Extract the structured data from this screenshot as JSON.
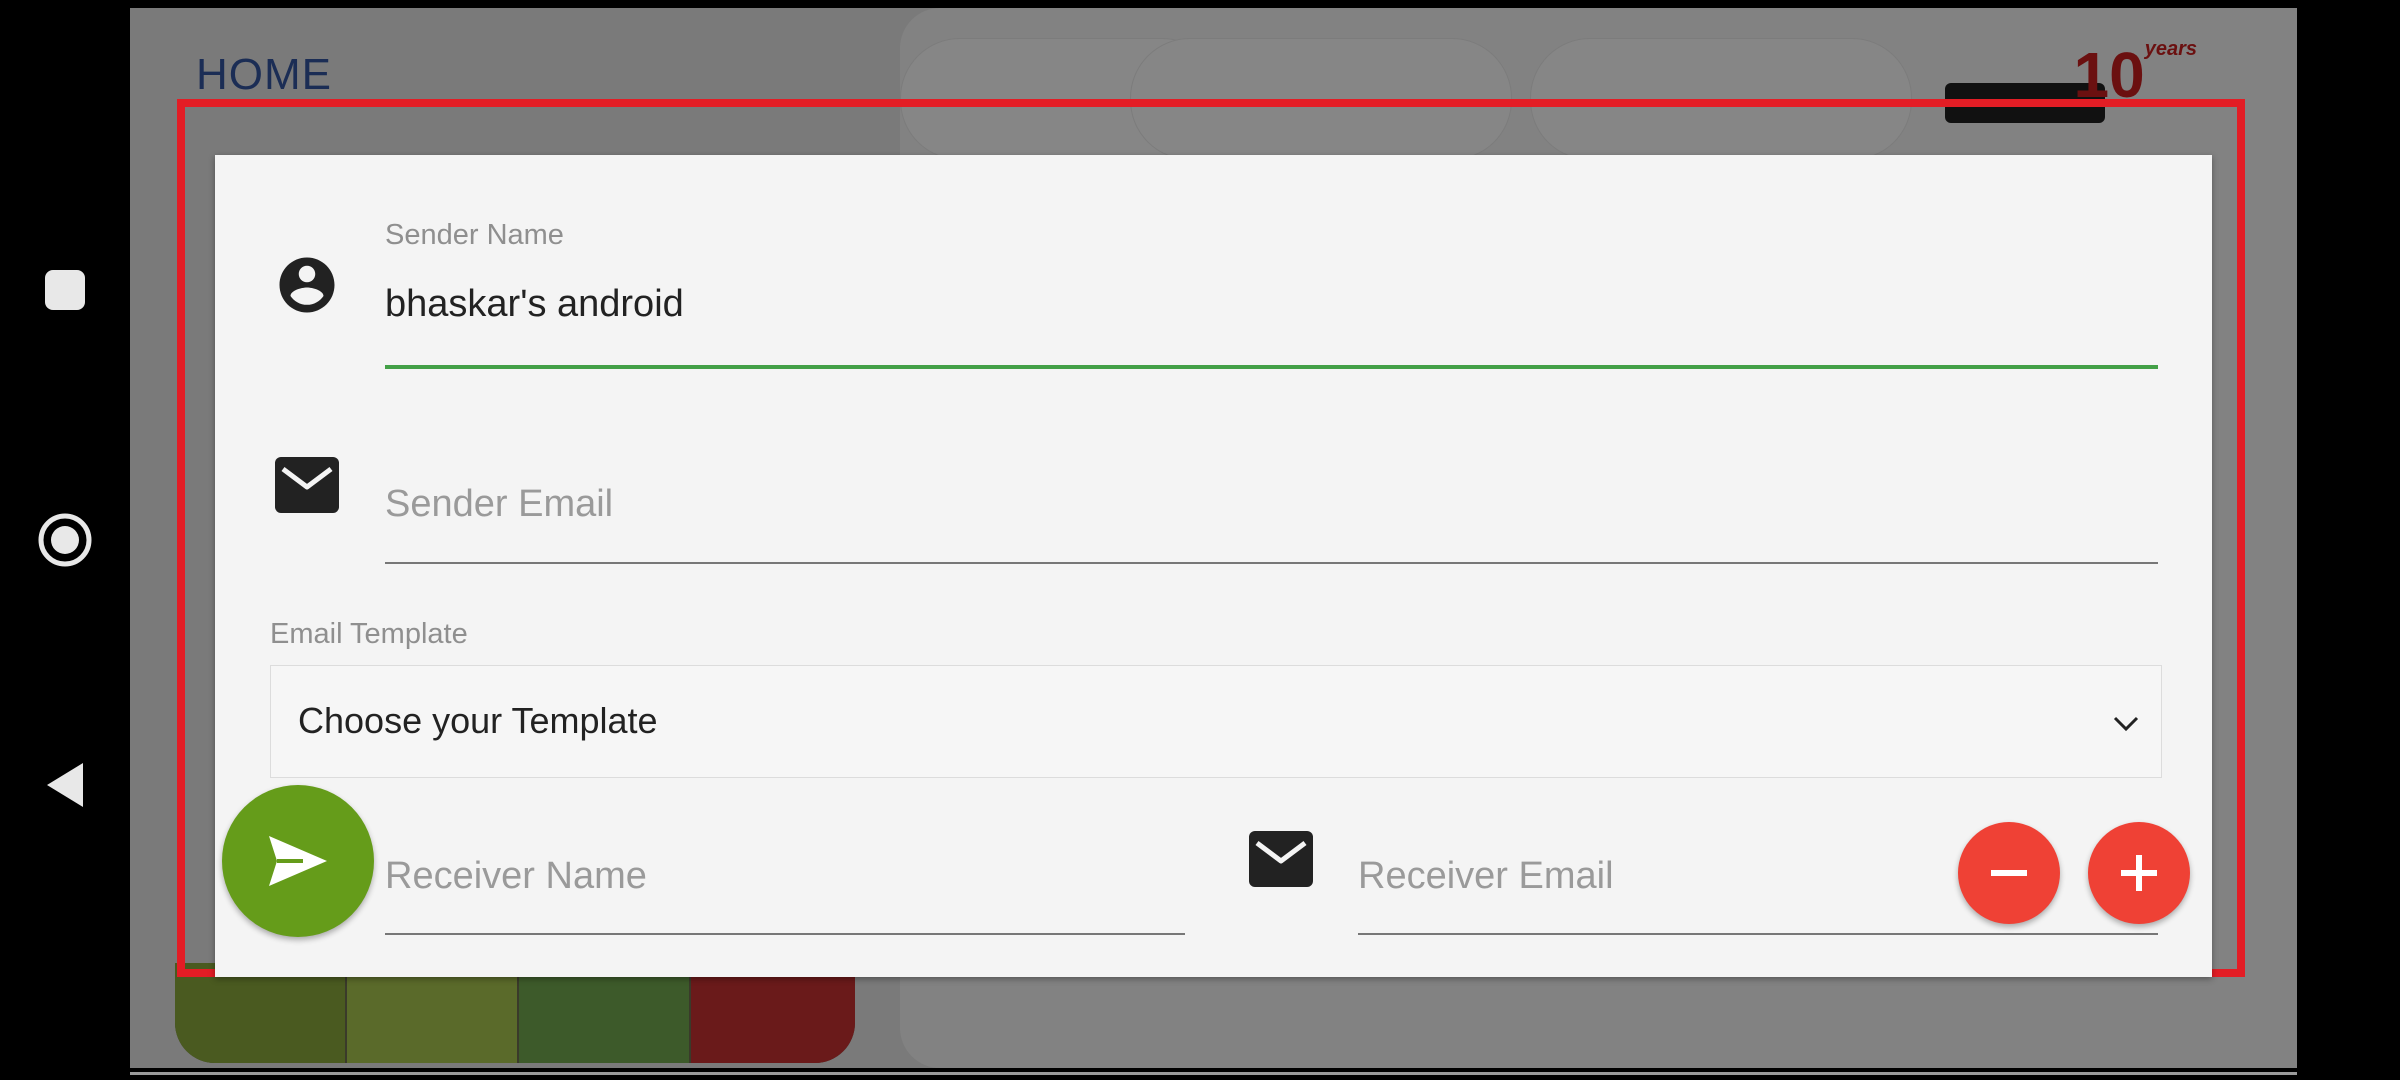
{
  "background": {
    "home_title": "HOME",
    "logo_text": "10",
    "logo_sub": "years"
  },
  "form": {
    "sender_name": {
      "label": "Sender Name",
      "value": "bhaskar's android",
      "icon": "account-circle-icon"
    },
    "sender_email": {
      "placeholder": "Sender Email",
      "icon": "mail-icon"
    },
    "email_template": {
      "label": "Email Template",
      "selected": "Choose your Template"
    },
    "receiver_name": {
      "placeholder": "Receiver Name"
    },
    "receiver_email": {
      "placeholder": "Receiver Email",
      "icon": "mail-icon"
    }
  },
  "actions": {
    "send": "send-icon",
    "remove": "minus-icon",
    "add": "plus-icon"
  },
  "colors": {
    "highlight": "#e31d25",
    "active_underline": "#43a047",
    "send_fab": "#659c1a",
    "action_fab": "#ef4135"
  }
}
